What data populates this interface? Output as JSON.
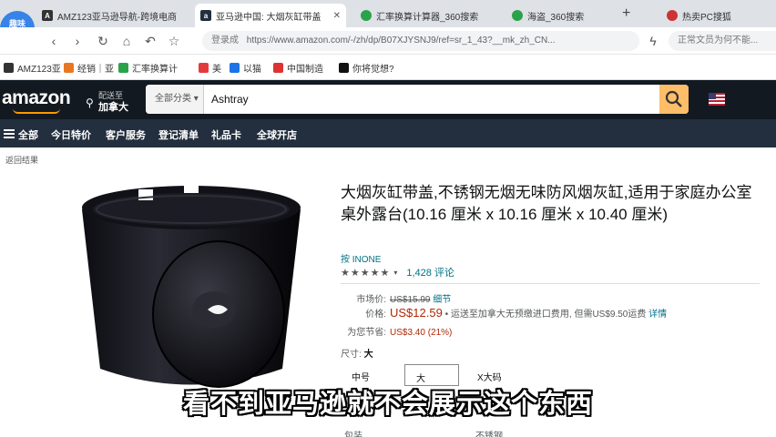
{
  "browser": {
    "tabs": [
      {
        "label": "AMZ123亚马逊导航-跨境电商",
        "color": "#333333",
        "glyph": "A",
        "active": false
      },
      {
        "label": "亚马逊中国: 大烟灰缸带盖",
        "color": "#232f3e",
        "glyph": "a",
        "active": true
      },
      {
        "label": "汇率换算计算器_360搜索",
        "color": "#2aa24a",
        "glyph": "",
        "active": false
      },
      {
        "label": "海盗_360搜索",
        "color": "#2aa24a",
        "glyph": "",
        "active": false
      },
      {
        "label": "热卖PC搜狐",
        "color": "#c33",
        "glyph": "",
        "active": false
      }
    ],
    "new_tab": "+",
    "address": {
      "secure_label": "登录成",
      "url": "https://www.amazon.com/-/zh/dp/B07XJYSNJ9/ref=sr_1_43?__mk_zh_CN..."
    },
    "right_search": "正常文员为何不能...",
    "bookmarks": [
      {
        "label": "AMZ123亚",
        "color": "#333333"
      },
      {
        "label": "经销｜亚",
        "color": "#e87722"
      },
      {
        "label": "汇率换算计",
        "color": "#2aa24a"
      },
      {
        "label": "美",
        "color": "#e4393c"
      },
      {
        "label": "以猫",
        "color": "#1a73e8"
      },
      {
        "label": "中国制造",
        "color": "#d33"
      },
      {
        "label": "你将觉想?",
        "color": "#111111"
      }
    ],
    "watermark": "趣味\n分享"
  },
  "amazon": {
    "logo": "amazon",
    "deliver": {
      "line1": "配送至",
      "line2": "加拿大"
    },
    "search": {
      "category": "全部分类",
      "value": "Ashtray"
    },
    "account": {
      "line1": "您好,登",
      "line2": "账户及"
    },
    "subnav": [
      "全部",
      "今日特价",
      "客户服务",
      "登记清单",
      "礼品卡",
      "全球开店"
    ]
  },
  "product": {
    "breadcrumb": "返回结果",
    "title": "大烟灰缸带盖,不锈钢无烟无味防风烟灰缸,适用于家庭办公室桌外露台(10.16 厘米 x 10.16 厘米 x 10.40 厘米)",
    "brand": "按 INONE",
    "stars": "★★★★★",
    "rating_count": "1,428 评论",
    "list_price_label": "市场价:",
    "list_price": "US$15.99",
    "list_price_note": "细节",
    "price_label": "价格:",
    "price": "US$12.59",
    "shipping_note": "• 运送至加拿大无预缴进口费用, 但需US$9.50运费",
    "shipping_link": "详情",
    "savings_label": "为您节省:",
    "savings": "US$3.40 (21%)",
    "size_label": "尺寸:",
    "size_value": "大",
    "sizes": [
      "中号",
      "大",
      "X大码"
    ],
    "extra_left": "包装",
    "extra_right": "不锈钢"
  },
  "subtitle": "看不到亚马逊就不会展示这个东西"
}
